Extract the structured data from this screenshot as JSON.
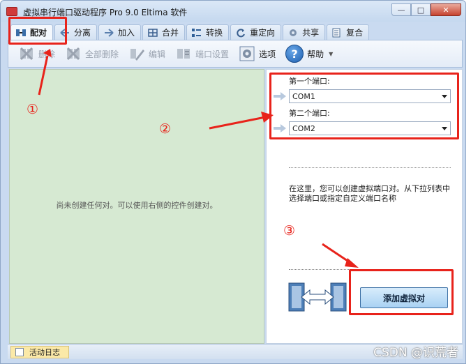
{
  "window": {
    "title": "虚拟串行端口驱动程序 Pro 9.0 Eltima 软件",
    "controls": {
      "minimize": "—",
      "maximize": "□",
      "close": "✕"
    }
  },
  "tabs": [
    {
      "label": "配对",
      "icon": "pair-icon",
      "active": true
    },
    {
      "label": "分离",
      "icon": "split-icon"
    },
    {
      "label": "加入",
      "icon": "join-icon"
    },
    {
      "label": "合并",
      "icon": "merge-icon"
    },
    {
      "label": "转换",
      "icon": "convert-icon"
    },
    {
      "label": "重定向",
      "icon": "redirect-icon"
    },
    {
      "label": "共享",
      "icon": "share-icon"
    },
    {
      "label": "复合",
      "icon": "composite-icon"
    }
  ],
  "toolbar": {
    "delete": "删除",
    "delete_all": "全部删除",
    "edit": "编辑",
    "port_settings": "端口设置",
    "options": "选项",
    "help": "帮助"
  },
  "left_pane": {
    "empty_message": "尚未创建任何对。可以使用右侧的控件创建对。"
  },
  "right_pane": {
    "first_port_label": "第一个端口:",
    "first_port_value": "COM1",
    "second_port_label": "第二个端口:",
    "second_port_value": "COM2",
    "description": "在这里，您可以创建虚拟端口对。从下拉列表中选择端口或指定自定义端口名称",
    "add_button": "添加虚拟对"
  },
  "status_bar": {
    "log_tab": "活动日志"
  },
  "annotations": [
    "①",
    "②",
    "③"
  ],
  "watermark": "CSDN @识荒者",
  "colors": {
    "annotation": "#e8231b",
    "left_pane_bg": "#d6e9d2",
    "chrome": "#c9daf0"
  }
}
